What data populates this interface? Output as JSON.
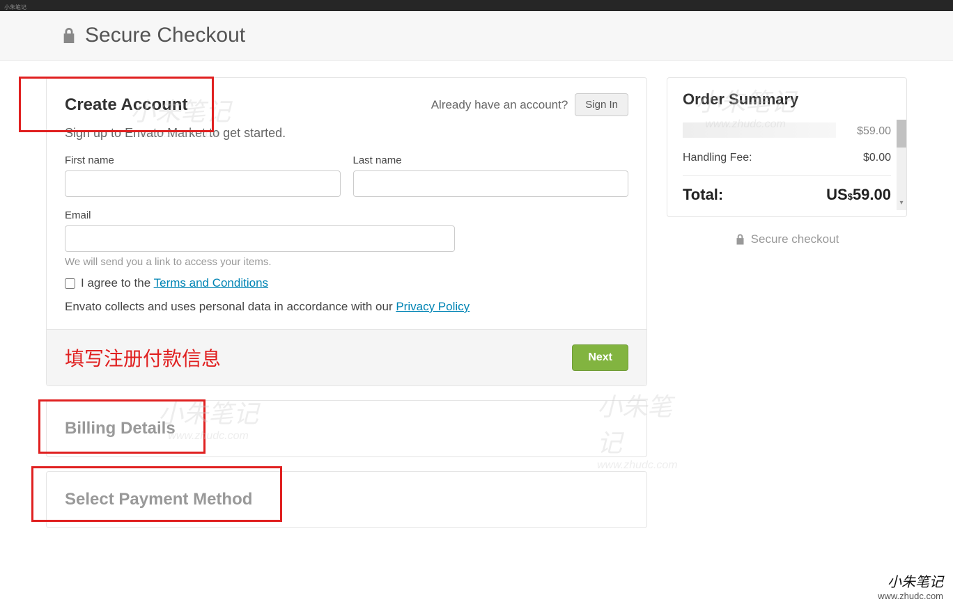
{
  "topbar": {
    "site_label": "小朱笔记"
  },
  "header": {
    "title": "Secure Checkout"
  },
  "account": {
    "title": "Create Account",
    "already_text": "Already have an account?",
    "signin_label": "Sign In",
    "subtext": "Sign up to Envato Market to get started.",
    "first_name_label": "First name",
    "last_name_label": "Last name",
    "email_label": "Email",
    "email_hint": "We will send you a link to access your items.",
    "agree_prefix": "I agree to the ",
    "terms_link": "Terms and Conditions",
    "privacy_prefix": "Envato collects and uses personal data in accordance with our ",
    "privacy_link": "Privacy Policy",
    "next_label": "Next"
  },
  "billing": {
    "title": "Billing Details"
  },
  "payment": {
    "title": "Select Payment Method"
  },
  "summary": {
    "title": "Order Summary",
    "item_label": "…",
    "item_price": "$59.00",
    "handling_label": "Handling Fee:",
    "handling_price": "$0.00",
    "total_label": "Total:",
    "total_currency": "US",
    "total_symbol": "$",
    "total_amount": "59.00",
    "secure_text": "Secure checkout"
  },
  "annotations": {
    "fill_info": "填写注册付款信息"
  },
  "watermark": {
    "text_cn": "小朱笔记",
    "text_url": "www.zhudc.com"
  }
}
